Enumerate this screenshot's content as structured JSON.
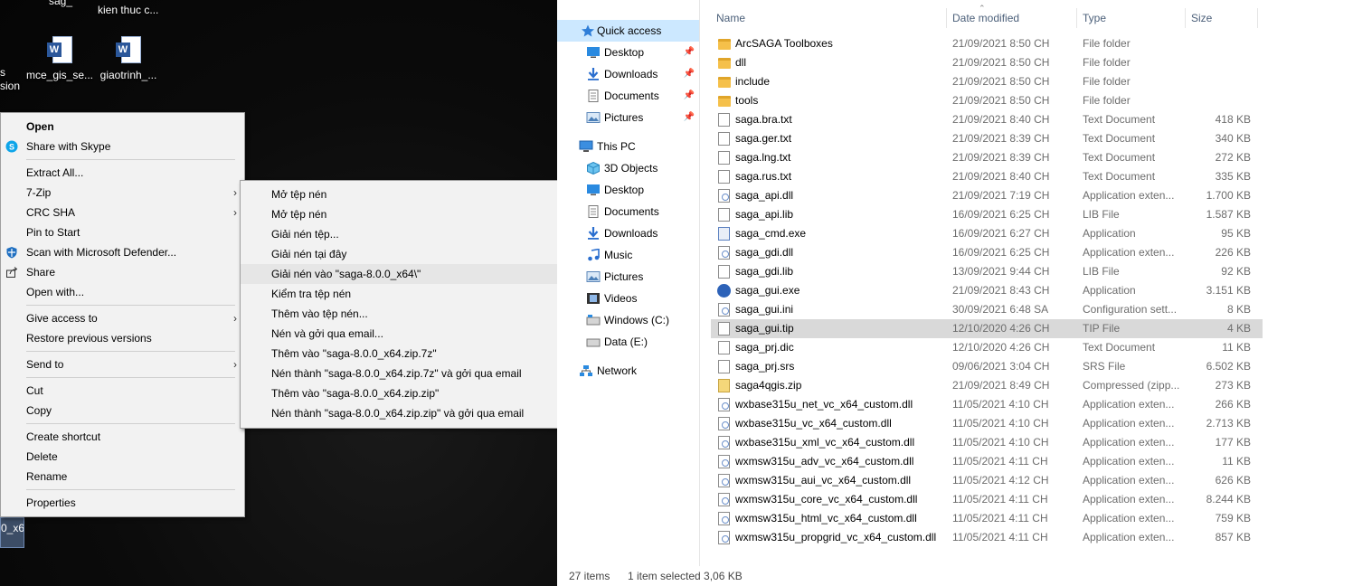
{
  "desktop": {
    "top_label_1": "kien thuc c...",
    "top_label_0": "sag_",
    "left_cut_label": "s",
    "left_cut_label_2": "sion",
    "icons": [
      {
        "label": "mce_gis_se...",
        "badge": "W"
      },
      {
        "label": "giaotrinh_...",
        "badge": "W"
      }
    ],
    "selected_file_label": "0_x6"
  },
  "context_menu": {
    "items": [
      {
        "label": "Open",
        "bold": true
      },
      {
        "label": "Share with Skype",
        "icon": "skype-icon"
      },
      {
        "label": "Extract All..."
      },
      {
        "label": "7-Zip",
        "submenu": true
      },
      {
        "label": "CRC SHA",
        "submenu": true
      },
      {
        "label": "Pin to Start"
      },
      {
        "label": "Scan with Microsoft Defender...",
        "icon": "defender-icon"
      },
      {
        "label": "Share",
        "icon": "share-icon"
      },
      {
        "label": "Open with..."
      },
      {
        "label": "Give access to",
        "submenu": true
      },
      {
        "label": "Restore previous versions"
      },
      {
        "label": "Send to",
        "submenu": true
      },
      {
        "label": "Cut"
      },
      {
        "label": "Copy"
      },
      {
        "label": "Create shortcut"
      },
      {
        "label": "Delete"
      },
      {
        "label": "Rename"
      },
      {
        "label": "Properties"
      }
    ],
    "arrow": "›"
  },
  "submenu_7zip": {
    "items": [
      "Mở tệp nén",
      "Mở tệp nén",
      "Giải nén tệp...",
      "Giải nén tại đây",
      "Giải nén vào \"saga-8.0.0_x64\\\"",
      "Kiểm tra tệp nén",
      "Thêm vào tệp nén...",
      "Nén và gởi qua email...",
      "Thêm vào \"saga-8.0.0_x64.zip.7z\"",
      "Nén thành \"saga-8.0.0_x64.zip.7z\" và gởi qua email",
      "Thêm vào \"saga-8.0.0_x64.zip.zip\"",
      "Nén thành \"saga-8.0.0_x64.zip.zip\" và gởi qua email"
    ],
    "highlighted_index": 4
  },
  "nav_pane": {
    "quick_access": "Quick access",
    "quick_items": [
      "Desktop",
      "Downloads",
      "Documents",
      "Pictures"
    ],
    "this_pc": "This PC",
    "pc_items": [
      "3D Objects",
      "Desktop",
      "Documents",
      "Downloads",
      "Music",
      "Pictures",
      "Videos",
      "Windows (C:)",
      "Data (E:)"
    ],
    "network": "Network"
  },
  "columns": {
    "name": "Name",
    "date": "Date modified",
    "type": "Type",
    "size": "Size"
  },
  "files": [
    {
      "name": "ArcSAGA Toolboxes",
      "date": "21/09/2021 8:50 CH",
      "type": "File folder",
      "size": "",
      "icon": "folder"
    },
    {
      "name": "dll",
      "date": "21/09/2021 8:50 CH",
      "type": "File folder",
      "size": "",
      "icon": "folder"
    },
    {
      "name": "include",
      "date": "21/09/2021 8:50 CH",
      "type": "File folder",
      "size": "",
      "icon": "folder"
    },
    {
      "name": "tools",
      "date": "21/09/2021 8:50 CH",
      "type": "File folder",
      "size": "",
      "icon": "folder"
    },
    {
      "name": "saga.bra.txt",
      "date": "21/09/2021 8:40 CH",
      "type": "Text Document",
      "size": "418 KB",
      "icon": "doc"
    },
    {
      "name": "saga.ger.txt",
      "date": "21/09/2021 8:39 CH",
      "type": "Text Document",
      "size": "340 KB",
      "icon": "doc"
    },
    {
      "name": "saga.lng.txt",
      "date": "21/09/2021 8:39 CH",
      "type": "Text Document",
      "size": "272 KB",
      "icon": "doc"
    },
    {
      "name": "saga.rus.txt",
      "date": "21/09/2021 8:40 CH",
      "type": "Text Document",
      "size": "335 KB",
      "icon": "doc"
    },
    {
      "name": "saga_api.dll",
      "date": "21/09/2021 7:19 CH",
      "type": "Application exten...",
      "size": "1.700 KB",
      "icon": "dll"
    },
    {
      "name": "saga_api.lib",
      "date": "16/09/2021 6:25 CH",
      "type": "LIB File",
      "size": "1.587 KB",
      "icon": "doc"
    },
    {
      "name": "saga_cmd.exe",
      "date": "16/09/2021 6:27 CH",
      "type": "Application",
      "size": "95 KB",
      "icon": "exe"
    },
    {
      "name": "saga_gdi.dll",
      "date": "16/09/2021 6:25 CH",
      "type": "Application exten...",
      "size": "226 KB",
      "icon": "dll"
    },
    {
      "name": "saga_gdi.lib",
      "date": "13/09/2021 9:44 CH",
      "type": "LIB File",
      "size": "92 KB",
      "icon": "doc"
    },
    {
      "name": "saga_gui.exe",
      "date": "21/09/2021 8:43 CH",
      "type": "Application",
      "size": "3.151 KB",
      "icon": "gui"
    },
    {
      "name": "saga_gui.ini",
      "date": "30/09/2021 6:48 SA",
      "type": "Configuration sett...",
      "size": "8 KB",
      "icon": "dll"
    },
    {
      "name": "saga_gui.tip",
      "date": "12/10/2020 4:26 CH",
      "type": "TIP File",
      "size": "4 KB",
      "icon": "doc",
      "selected": true
    },
    {
      "name": "saga_prj.dic",
      "date": "12/10/2020 4:26 CH",
      "type": "Text Document",
      "size": "11 KB",
      "icon": "doc"
    },
    {
      "name": "saga_prj.srs",
      "date": "09/06/2021 3:04 CH",
      "type": "SRS File",
      "size": "6.502 KB",
      "icon": "doc"
    },
    {
      "name": "saga4qgis.zip",
      "date": "21/09/2021 8:49 CH",
      "type": "Compressed (zipp...",
      "size": "273 KB",
      "icon": "zip"
    },
    {
      "name": "wxbase315u_net_vc_x64_custom.dll",
      "date": "11/05/2021 4:10 CH",
      "type": "Application exten...",
      "size": "266 KB",
      "icon": "dll"
    },
    {
      "name": "wxbase315u_vc_x64_custom.dll",
      "date": "11/05/2021 4:10 CH",
      "type": "Application exten...",
      "size": "2.713 KB",
      "icon": "dll"
    },
    {
      "name": "wxbase315u_xml_vc_x64_custom.dll",
      "date": "11/05/2021 4:10 CH",
      "type": "Application exten...",
      "size": "177 KB",
      "icon": "dll"
    },
    {
      "name": "wxmsw315u_adv_vc_x64_custom.dll",
      "date": "11/05/2021 4:11 CH",
      "type": "Application exten...",
      "size": "11 KB",
      "icon": "dll"
    },
    {
      "name": "wxmsw315u_aui_vc_x64_custom.dll",
      "date": "11/05/2021 4:12 CH",
      "type": "Application exten...",
      "size": "626 KB",
      "icon": "dll"
    },
    {
      "name": "wxmsw315u_core_vc_x64_custom.dll",
      "date": "11/05/2021 4:11 CH",
      "type": "Application exten...",
      "size": "8.244 KB",
      "icon": "dll"
    },
    {
      "name": "wxmsw315u_html_vc_x64_custom.dll",
      "date": "11/05/2021 4:11 CH",
      "type": "Application exten...",
      "size": "759 KB",
      "icon": "dll"
    },
    {
      "name": "wxmsw315u_propgrid_vc_x64_custom.dll",
      "date": "11/05/2021 4:11 CH",
      "type": "Application exten...",
      "size": "857 KB",
      "icon": "dll"
    }
  ],
  "status": {
    "count": "27 items",
    "selection": "1 item selected  3,06 KB"
  },
  "colors": {
    "nav_selected": "#cce8ff",
    "row_selected": "#d9d9d9",
    "menu_bg": "#f2f2f2"
  }
}
